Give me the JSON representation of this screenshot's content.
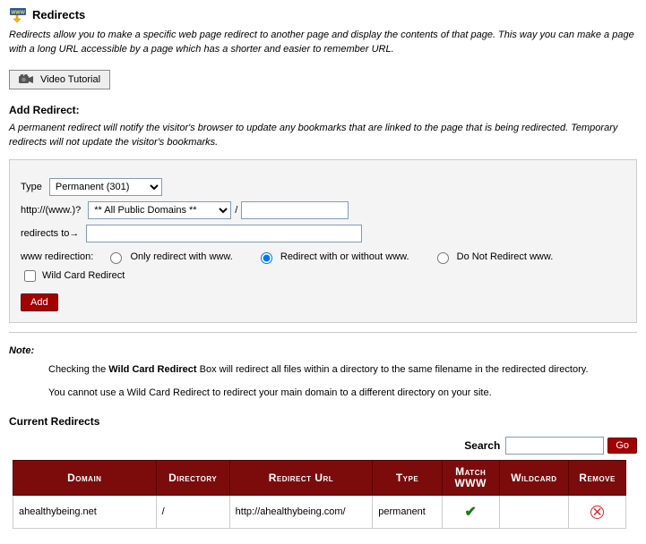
{
  "header": {
    "title": "Redirects",
    "intro": "Redirects allow you to make a specific web page redirect to another page and display the contents of that page. This way you can make a page with a long URL accessible by a page which has a shorter and easier to remember URL."
  },
  "videoButton": {
    "label": "Video Tutorial"
  },
  "addRedirect": {
    "heading": "Add Redirect:",
    "explain": "A permanent redirect will notify the visitor's browser to update any bookmarks that are linked to the page that is being redirected. Temporary redirects will not update the visitor's bookmarks.",
    "typeLabel": "Type",
    "typeValue": "Permanent (301)",
    "httpLabel": "http://(www.)?",
    "domainValue": "** All Public Domains **",
    "slash": "/",
    "pathValue": "",
    "redirectsToLabel": "redirects to→",
    "redirectsToValue": "",
    "wwwLabel": "www redirection:",
    "wwwOpt1": "Only redirect with www.",
    "wwwOpt2": "Redirect with or without www.",
    "wwwOpt3": "Do Not Redirect www.",
    "wildcardLabel": "Wild Card Redirect",
    "addBtn": "Add"
  },
  "note": {
    "label": "Note:",
    "p1a": "Checking the ",
    "p1b": "Wild Card Redirect",
    "p1c": " Box will redirect all files within a directory to the same filename in the redirected directory.",
    "p2": "You cannot use a Wild Card Redirect to redirect your main domain to a different directory on your site."
  },
  "current": {
    "heading": "Current Redirects",
    "searchLabel": "Search",
    "searchValue": "",
    "goBtn": "Go",
    "columns": {
      "domain": "Domain",
      "directory": "Directory",
      "redirectUrl": "Redirect Url",
      "type": "Type",
      "matchWww": "Match WWW",
      "wildcard": "Wildcard",
      "remove": "Remove"
    },
    "row": {
      "domain": "ahealthybeing.net",
      "directory": "/",
      "redirectUrl": "http://ahealthybeing.com/",
      "type": "permanent",
      "matchWww": true,
      "wildcard": ""
    }
  }
}
